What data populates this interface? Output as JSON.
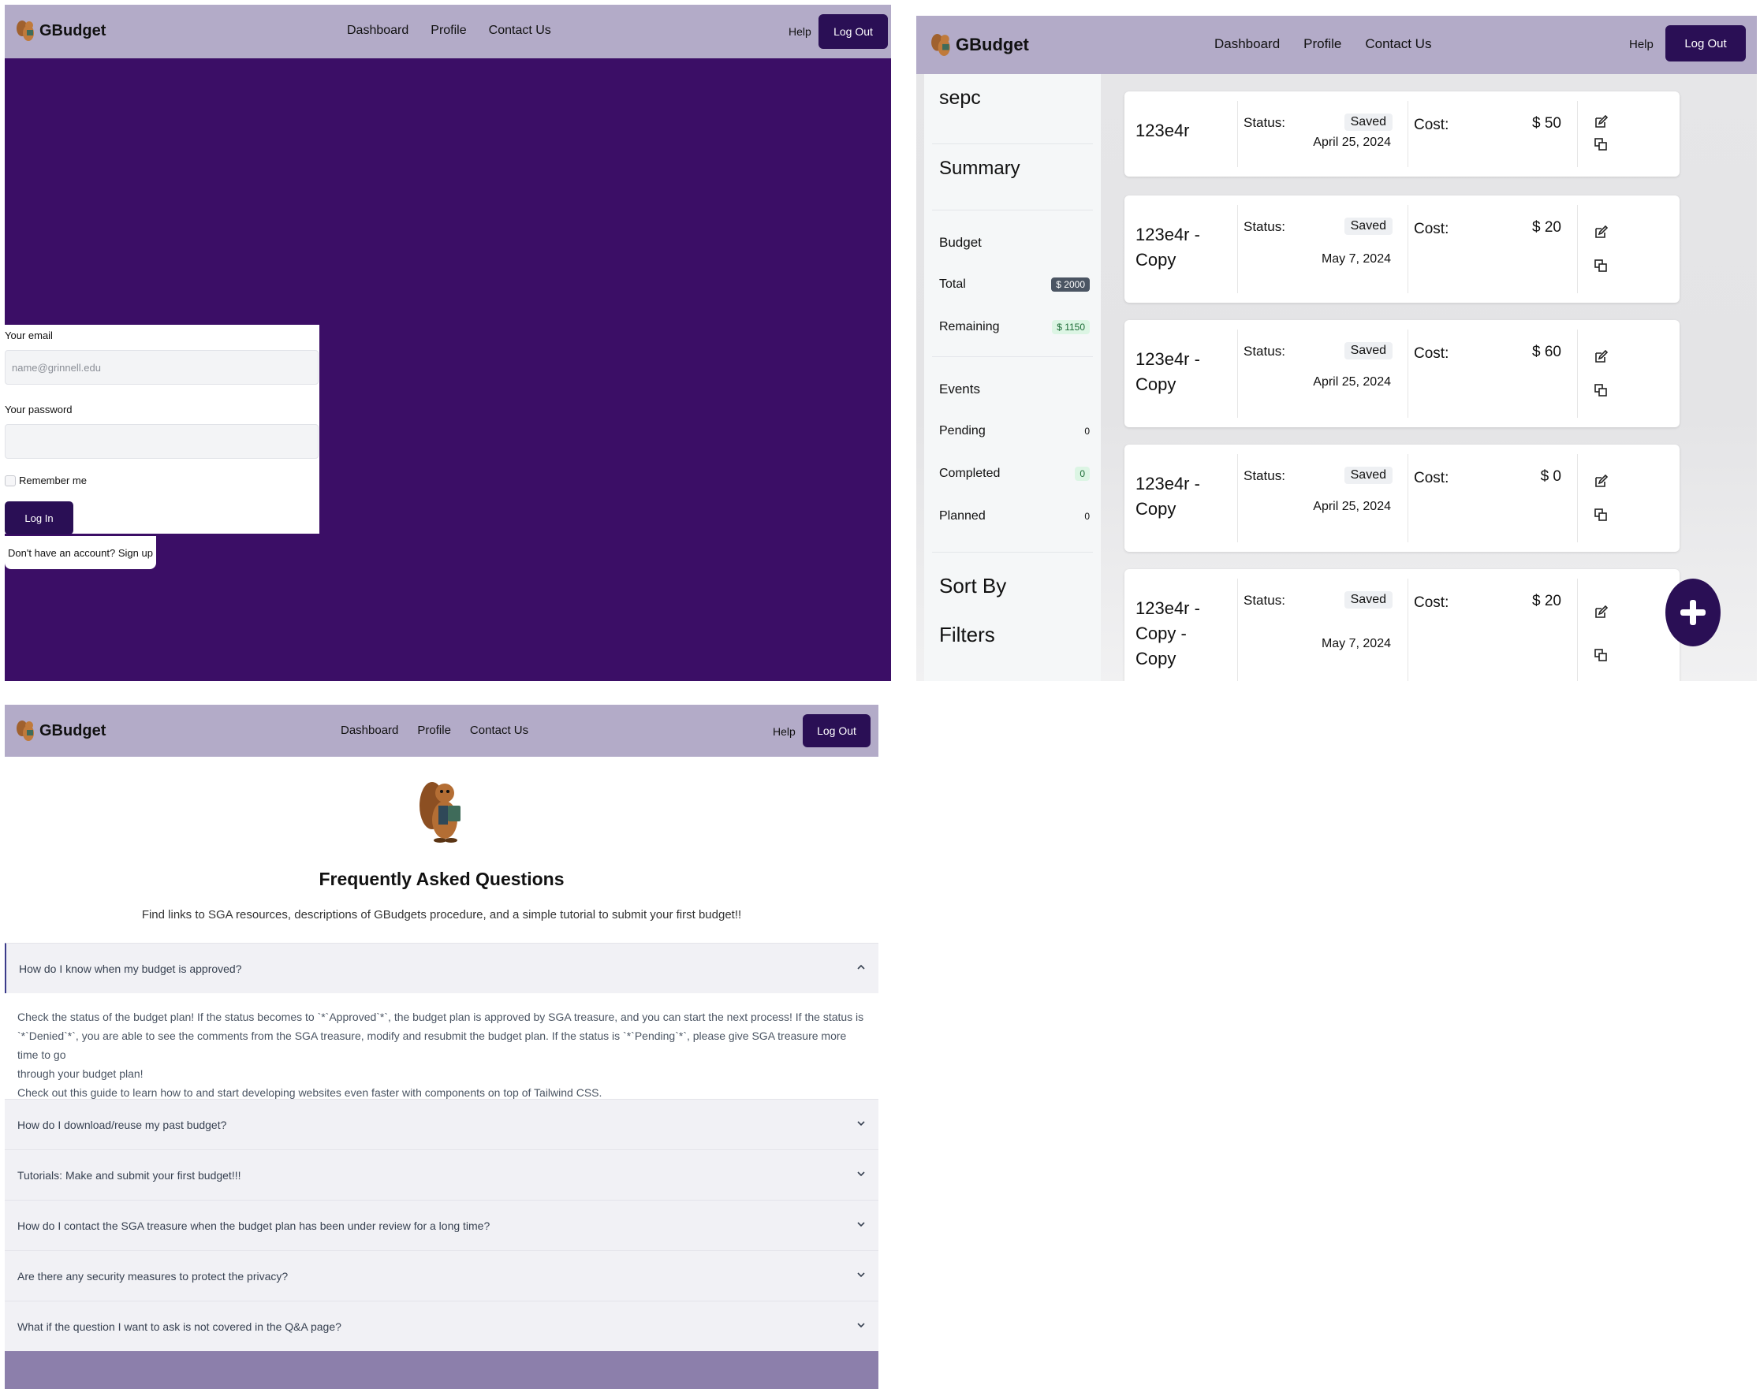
{
  "brand": {
    "name": "GBudget",
    "logo_icon": "squirrel-mascot-icon"
  },
  "nav": {
    "links": [
      "Dashboard",
      "Profile",
      "Contact Us"
    ],
    "help": "Help",
    "logout": "Log Out"
  },
  "login": {
    "email_label": "Your email",
    "email_placeholder": "name@grinnell.edu",
    "password_label": "Your password",
    "remember_label": "Remember me",
    "login_button": "Log In",
    "signup_link": "Don't have an account? Sign up"
  },
  "dashboard": {
    "sidebar": {
      "user": "sepc",
      "summary": "Summary",
      "budget_heading": "Budget",
      "total_label": "Total",
      "total_value": "$ 2000",
      "remaining_label": "Remaining",
      "remaining_value": "$ 1150",
      "events_heading": "Events",
      "pending_label": "Pending",
      "pending_value": "0",
      "completed_label": "Completed",
      "completed_value": "0",
      "planned_label": "Planned",
      "planned_value": "0",
      "sort_by": "Sort By",
      "filters": "Filters"
    },
    "status_label": "Status:",
    "cost_label": "Cost:",
    "budgets": [
      {
        "name": "123e4r",
        "status": "Saved",
        "date": "April 25, 2024",
        "cost": "$ 50"
      },
      {
        "name": "123e4r - Copy",
        "status": "Saved",
        "date": "May 7, 2024",
        "cost": "$ 20"
      },
      {
        "name": "123e4r - Copy",
        "status": "Saved",
        "date": "April 25, 2024",
        "cost": "$ 60"
      },
      {
        "name": "123e4r - Copy",
        "status": "Saved",
        "date": "April 25, 2024",
        "cost": "$ 0"
      },
      {
        "name": "123e4r - Copy - Copy",
        "status": "Saved",
        "date": "May 7, 2024",
        "cost": "$ 20"
      }
    ],
    "add_button_icon": "plus-icon"
  },
  "faq": {
    "title": "Frequently Asked Questions",
    "subtitle": "Find links to SGA resources, descriptions of GBudgets procedure, and a simple tutorial to submit your first budget!!",
    "questions": [
      "How do I know when my budget is approved?",
      "How do I download/reuse my past budget?",
      "Tutorials: Make and submit your first budget!!!",
      "How do I contact the SGA treasure when the budget plan has been under review for a long time?",
      "Are there any security measures to protect the privacy?",
      "What if the question I want to ask is not covered in the Q&A page?"
    ],
    "answer_lines": [
      "Check the status of the budget plan! If the status becomes to `*`Approved`*`, the budget plan is approved by SGA treasure, and you can start the next process! If the status is",
      "`*`Denied`*`, you are able to see the comments from the SGA treasure, modify and resubmit the budget plan. If the status is `*`Pending`*`, please give SGA treasure more time to go",
      "through your budget plan!",
      "Check out this guide to learn how to  and start developing websites even faster with components on top of Tailwind CSS."
    ]
  },
  "colors": {
    "nav_bg": "#b3abc8",
    "accent": "#2a0f55",
    "login_bg": "#3b0e66",
    "footer": "#8c7fab"
  }
}
